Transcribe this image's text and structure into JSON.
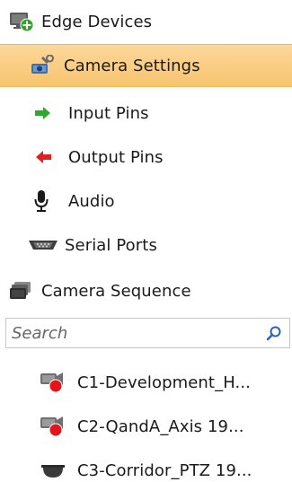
{
  "tree": {
    "edge_devices": {
      "label": "Edge Devices",
      "icon": "monitor-add-icon"
    },
    "camera_settings": {
      "label": "Camera Settings",
      "icon": "camera-wrench-icon"
    },
    "input_pins": {
      "label": "Input Pins",
      "icon": "arrow-right-icon"
    },
    "output_pins": {
      "label": "Output Pins",
      "icon": "arrow-left-icon"
    },
    "audio": {
      "label": "Audio",
      "icon": "microphone-icon"
    },
    "serial_ports": {
      "label": "Serial Ports",
      "icon": "serial-port-icon"
    },
    "camera_sequence": {
      "label": "Camera Sequence",
      "icon": "camera-stack-icon"
    }
  },
  "search": {
    "placeholder": "Search",
    "value": ""
  },
  "cameras": [
    {
      "label": "C1-Development_H...",
      "icon": "camera-offline-icon"
    },
    {
      "label": "C2-QandA_Axis 19...",
      "icon": "camera-offline-icon"
    },
    {
      "label": "C3-Corridor_PTZ 19...",
      "icon": "dome-camera-icon"
    }
  ],
  "colors": {
    "selected_bg": "#f8c46e",
    "input_arrow": "#2ea82e",
    "output_arrow": "#e02020",
    "status_red": "#e3141b",
    "search_icon": "#2a62b5"
  }
}
